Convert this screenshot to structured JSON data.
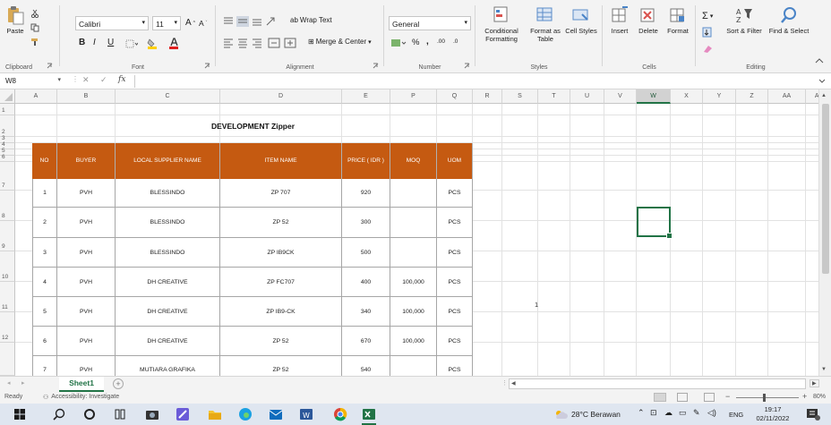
{
  "ribbon": {
    "clipboard": {
      "paste": "Paste",
      "label": "Clipboard"
    },
    "font": {
      "name": "Calibri",
      "size": "11",
      "label": "Font",
      "bold": "B",
      "italic": "I",
      "underline": "U",
      "grow": "A",
      "shrink": "A"
    },
    "alignment": {
      "wrap": "Wrap Text",
      "merge": "Merge & Center",
      "label": "Alignment"
    },
    "number": {
      "format": "General",
      "label": "Number",
      "percent": "%",
      "comma": ",",
      "inc": ".00",
      "dec": ".0"
    },
    "styles": {
      "conditional": "Conditional Formatting",
      "format_table": "Format as Table",
      "cell_styles": "Cell Styles",
      "label": "Styles"
    },
    "cells": {
      "insert": "Insert",
      "delete": "Delete",
      "format": "Format",
      "label": "Cells"
    },
    "editing": {
      "sort": "Sort & Filter",
      "find": "Find & Select",
      "label": "Editing"
    }
  },
  "formula_bar": {
    "name_box": "W8",
    "fx": "fx",
    "value": ""
  },
  "columns": [
    "A",
    "B",
    "C",
    "D",
    "E",
    "P",
    "Q",
    "R",
    "S",
    "T",
    "U",
    "V",
    "W",
    "X",
    "Y",
    "Z",
    "AA",
    "AB"
  ],
  "selected_column": "W",
  "rows": [
    "1",
    "2",
    "3",
    "4",
    "5",
    "6",
    "7",
    "8",
    "9",
    "10",
    "11",
    "12"
  ],
  "sheet": {
    "title": "DEVELOPMENT Zipper",
    "headers": {
      "no": "NO",
      "buyer": "BUYER",
      "supplier": "LOCAL SUPPLIER NAME",
      "item": "ITEM NAME",
      "price": "PRICE ( IDR )",
      "moq": "MOQ",
      "uom": "UOM"
    },
    "items": [
      {
        "no": "1",
        "buyer": "PVH",
        "supplier": "BLESSINDO",
        "item": "ZP 707",
        "price": "920",
        "moq": "",
        "uom": "PCS"
      },
      {
        "no": "2",
        "buyer": "PVH",
        "supplier": "BLESSINDO",
        "item": "ZP 52",
        "price": "300",
        "moq": "",
        "uom": "PCS"
      },
      {
        "no": "3",
        "buyer": "PVH",
        "supplier": "BLESSINDO",
        "item": "ZP IB9CK",
        "price": "500",
        "moq": "",
        "uom": "PCS"
      },
      {
        "no": "4",
        "buyer": "PVH",
        "supplier": "DH CREATIVE",
        "item": "ZP FC707",
        "price": "400",
        "moq": "100,000",
        "uom": "PCS"
      },
      {
        "no": "5",
        "buyer": "PVH",
        "supplier": "DH CREATIVE",
        "item": "ZP IB9-CK",
        "price": "340",
        "moq": "100,000",
        "uom": "PCS"
      },
      {
        "no": "6",
        "buyer": "PVH",
        "supplier": "DH CREATIVE",
        "item": "ZP 52",
        "price": "670",
        "moq": "100,000",
        "uom": "PCS"
      },
      {
        "no": "7",
        "buyer": "PVH",
        "supplier": "MUTIARA GRAFIKA",
        "item": "ZP 52",
        "price": "540",
        "moq": "",
        "uom": "PCS"
      }
    ],
    "s_value": "1"
  },
  "tabs": {
    "active": "Sheet1"
  },
  "status": {
    "ready": "Ready",
    "accessibility": "Accessibility: Investigate",
    "zoom": "80%"
  },
  "taskbar": {
    "weather": "28°C Berawan",
    "lang": "ENG",
    "time": "19:17",
    "date": "02/11/2022"
  },
  "colors": {
    "header_fill": "#c55a11",
    "excel_green": "#217346"
  }
}
